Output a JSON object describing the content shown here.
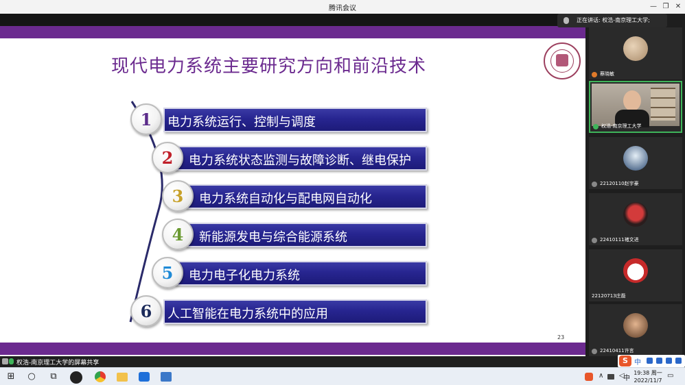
{
  "window": {
    "title": "腾讯会议",
    "minimize": "—",
    "maximize": "❐",
    "close": "✕"
  },
  "slide": {
    "title": "现代电力系统主要研究方向和前沿技术",
    "page_number": "23",
    "items": [
      {
        "num": "1",
        "label": "电力系统运行、控制与调度",
        "color": "#5b2c8a"
      },
      {
        "num": "2",
        "label": "电力系统状态监测与故障诊断、继电保护",
        "color": "#c0202a"
      },
      {
        "num": "3",
        "label": "电力系统自动化与配电网自动化",
        "color": "#c7a12a"
      },
      {
        "num": "4",
        "label": "新能源发电与综合能源系统",
        "color": "#6b9a32"
      },
      {
        "num": "5",
        "label": "电力电子化电力系统",
        "color": "#1f8ad6"
      },
      {
        "num": "6",
        "label": "人工智能在电力系统中的应用",
        "color": "#1b2a5a"
      }
    ],
    "accent": "#6b2a8f",
    "bar_color": "#272590"
  },
  "meeting": {
    "speaking": "正在讲话: 权浩-南京理工大学;",
    "participants": [
      {
        "name": "蔡晓敏"
      },
      {
        "name": "权浩-南京理工大学"
      },
      {
        "name": "22120110赵宇豪"
      },
      {
        "name": "22410111褚文进"
      },
      {
        "name": "22120713庄磊"
      },
      {
        "name": "22410411许言"
      }
    ],
    "share_label": "权浩-南京理工大学的屏幕共享"
  },
  "ime": {
    "logo": "S",
    "mode": "中"
  },
  "taskbar": {
    "start_icon": "⊞",
    "search_icon": "○",
    "taskview_icon": "⧉",
    "time": "19:38 周一",
    "date": "2022/11/7",
    "tray_up": "∧",
    "tray_lang": "中",
    "tray_notify": "▭"
  }
}
